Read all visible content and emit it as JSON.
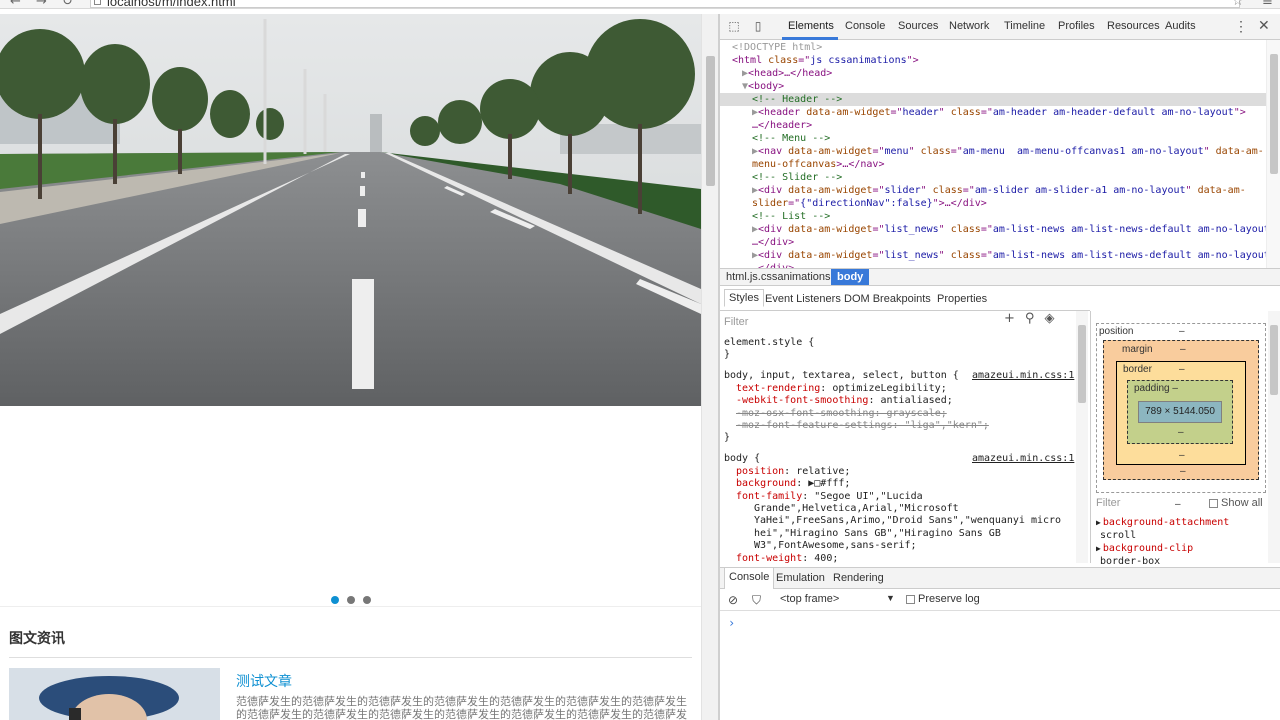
{
  "browser": {
    "url": "localhost/m/index.html",
    "back_glyph": "←",
    "forward_glyph": "→",
    "reload_glyph": "↻",
    "star_glyph": "☆",
    "menu_glyph": "≡"
  },
  "page": {
    "slider_dots": 3,
    "active_dot": 0,
    "section_title": "图文资讯",
    "news": {
      "title": "测试文章",
      "desc": "范德萨发生的范德萨发生的范德萨发生的范德萨发生的范德萨发生的范德萨发生的范德萨发生的范德萨发生的范德萨发生的范德萨发生的范德萨发生的范德萨发生的范德萨发生的范德萨发生的"
    }
  },
  "devtools": {
    "tabs": [
      "Elements",
      "Console",
      "Sources",
      "Network",
      "Timeline",
      "Profiles",
      "Resources",
      "Audits"
    ],
    "active_tab": "Elements",
    "dom": [
      {
        "indent": 0,
        "parts": [
          [
            "dt",
            "<!DOCTYPE html>"
          ]
        ]
      },
      {
        "indent": 0,
        "parts": [
          [
            "tag",
            "<html "
          ],
          [
            "attr",
            "class"
          ],
          [
            "tag",
            "=\""
          ],
          [
            "val",
            "js cssanimations"
          ],
          [
            "tag",
            "\">"
          ]
        ]
      },
      {
        "indent": 1,
        "parts": [
          [
            "dt",
            "▶"
          ],
          [
            "tag",
            "<head>…</head>"
          ]
        ]
      },
      {
        "indent": 1,
        "parts": [
          [
            "dt",
            "▼"
          ],
          [
            "tag",
            "<body>"
          ]
        ]
      },
      {
        "indent": 2,
        "parts": [
          [
            "cmt",
            "<!-- Header -->"
          ]
        ]
      },
      {
        "indent": 2,
        "parts": [
          [
            "dt",
            "▶"
          ],
          [
            "tag",
            "<header "
          ],
          [
            "attr",
            "data-am-widget"
          ],
          [
            "tag",
            "=\""
          ],
          [
            "val",
            "header"
          ],
          [
            "tag",
            "\" "
          ],
          [
            "attr",
            "class"
          ],
          [
            "tag",
            "=\""
          ],
          [
            "val",
            "am-header am-header-default am-no-layout"
          ],
          [
            "tag",
            "\">"
          ]
        ]
      },
      {
        "indent": 2,
        "parts": [
          [
            "tag",
            "…</header>"
          ]
        ]
      },
      {
        "indent": 2,
        "parts": [
          [
            "cmt",
            "<!-- Menu -->"
          ]
        ]
      },
      {
        "indent": 2,
        "parts": [
          [
            "dt",
            "▶"
          ],
          [
            "tag",
            "<nav "
          ],
          [
            "attr",
            "data-am-widget"
          ],
          [
            "tag",
            "=\""
          ],
          [
            "val",
            "menu"
          ],
          [
            "tag",
            "\" "
          ],
          [
            "attr",
            "class"
          ],
          [
            "tag",
            "=\""
          ],
          [
            "val",
            "am-menu  am-menu-offcanvas1 am-no-layout"
          ],
          [
            "tag",
            "\" "
          ],
          [
            "attr",
            "data-am-"
          ]
        ]
      },
      {
        "indent": 2,
        "parts": [
          [
            "attr",
            "menu-offcanvas"
          ],
          [
            "tag",
            ">…</nav>"
          ]
        ]
      },
      {
        "indent": 2,
        "parts": [
          [
            "cmt",
            "<!-- Slider -->"
          ]
        ]
      },
      {
        "indent": 2,
        "parts": [
          [
            "dt",
            "▶"
          ],
          [
            "tag",
            "<div "
          ],
          [
            "attr",
            "data-am-widget"
          ],
          [
            "tag",
            "=\""
          ],
          [
            "val",
            "slider"
          ],
          [
            "tag",
            "\" "
          ],
          [
            "attr",
            "class"
          ],
          [
            "tag",
            "=\""
          ],
          [
            "val",
            "am-slider am-slider-a1 am-no-layout"
          ],
          [
            "tag",
            "\" "
          ],
          [
            "attr",
            "data-am-"
          ]
        ]
      },
      {
        "indent": 2,
        "parts": [
          [
            "attr",
            "slider"
          ],
          [
            "tag",
            "=\""
          ],
          [
            "val",
            "{\"directionNav\":false}"
          ],
          [
            "tag",
            "\">…</div>"
          ]
        ]
      },
      {
        "indent": 2,
        "parts": [
          [
            "cmt",
            "<!-- List -->"
          ]
        ]
      },
      {
        "indent": 2,
        "parts": [
          [
            "dt",
            "▶"
          ],
          [
            "tag",
            "<div "
          ],
          [
            "attr",
            "data-am-widget"
          ],
          [
            "tag",
            "=\""
          ],
          [
            "val",
            "list_news"
          ],
          [
            "tag",
            "\" "
          ],
          [
            "attr",
            "class"
          ],
          [
            "tag",
            "=\""
          ],
          [
            "val",
            "am-list-news am-list-news-default am-no-layout"
          ],
          [
            "tag",
            "\">"
          ]
        ]
      },
      {
        "indent": 2,
        "parts": [
          [
            "tag",
            "…</div>"
          ]
        ]
      },
      {
        "indent": 2,
        "parts": [
          [
            "dt",
            "▶"
          ],
          [
            "tag",
            "<div "
          ],
          [
            "attr",
            "data-am-widget"
          ],
          [
            "tag",
            "=\""
          ],
          [
            "val",
            "list_news"
          ],
          [
            "tag",
            "\" "
          ],
          [
            "attr",
            "class"
          ],
          [
            "tag",
            "=\""
          ],
          [
            "val",
            "am-list-news am-list-news-default am-no-layout"
          ],
          [
            "tag",
            "\">"
          ]
        ]
      },
      {
        "indent": 2,
        "parts": [
          [
            "tag",
            "…</div>"
          ]
        ]
      }
    ],
    "breadcrumbs": [
      "html.js.cssanimations",
      "body"
    ],
    "sub_tabs": [
      "Styles",
      "Event Listeners",
      "DOM Breakpoints",
      "Properties"
    ],
    "styles_filter_placeholder": "Filter",
    "styles": [
      {
        "kind": "sel",
        "text": "element.style {"
      },
      {
        "kind": "sel",
        "text": "}"
      },
      {
        "kind": "gap"
      },
      {
        "kind": "selsrc",
        "text": "body, input, textarea, select, button {",
        "src": "amazeui.min.css:1"
      },
      {
        "kind": "prop",
        "prop": "text-rendering",
        "value": "optimizeLegibility;"
      },
      {
        "kind": "prop",
        "prop": "-webkit-font-smoothing",
        "value": "antialiased;"
      },
      {
        "kind": "strike",
        "prop": "-moz-osx-font-smoothing",
        "value": "grayscale;"
      },
      {
        "kind": "strike",
        "prop": "-moz-font-feature-settings",
        "value": "\"liga\",\"kern\";"
      },
      {
        "kind": "sel",
        "text": "}"
      },
      {
        "kind": "gap"
      },
      {
        "kind": "selsrc",
        "text": "body {",
        "src": "amazeui.min.css:1"
      },
      {
        "kind": "prop",
        "prop": "position",
        "value": "relative;"
      },
      {
        "kind": "prop",
        "prop": "background",
        "value": "▶□#fff;"
      },
      {
        "kind": "prop",
        "prop": "font-family",
        "value": "\"Segoe UI\",\"Lucida"
      },
      {
        "kind": "cont",
        "text": "Grande\",Helvetica,Arial,\"Microsoft"
      },
      {
        "kind": "cont",
        "text": "YaHei\",FreeSans,Arimo,\"Droid Sans\",\"wenquanyi micro"
      },
      {
        "kind": "cont",
        "text": "hei\",\"Hiragino Sans GB\",\"Hiragino Sans GB"
      },
      {
        "kind": "cont",
        "text": "W3\",FontAwesome,sans-serif;"
      },
      {
        "kind": "prop",
        "prop": "font-weight",
        "value": "400;"
      }
    ],
    "metrics": {
      "position": "position",
      "position_val": "–",
      "margin": "margin",
      "margin_val": "–",
      "border": "border",
      "border_val": "–",
      "padding": "padding –",
      "content": "789 × 5144.050",
      "dash": "–",
      "filter_placeholder": "Filter",
      "show_all": "Show all"
    },
    "computed": [
      {
        "prop": "background-attachment",
        "value": "scroll"
      },
      {
        "prop": "background-clip",
        "value": "border-box"
      }
    ],
    "drawer_tabs": [
      "Console",
      "Emulation",
      "Rendering"
    ],
    "console": {
      "frame": "<top frame>",
      "preserve_log": "Preserve log",
      "prompt": "›"
    }
  }
}
